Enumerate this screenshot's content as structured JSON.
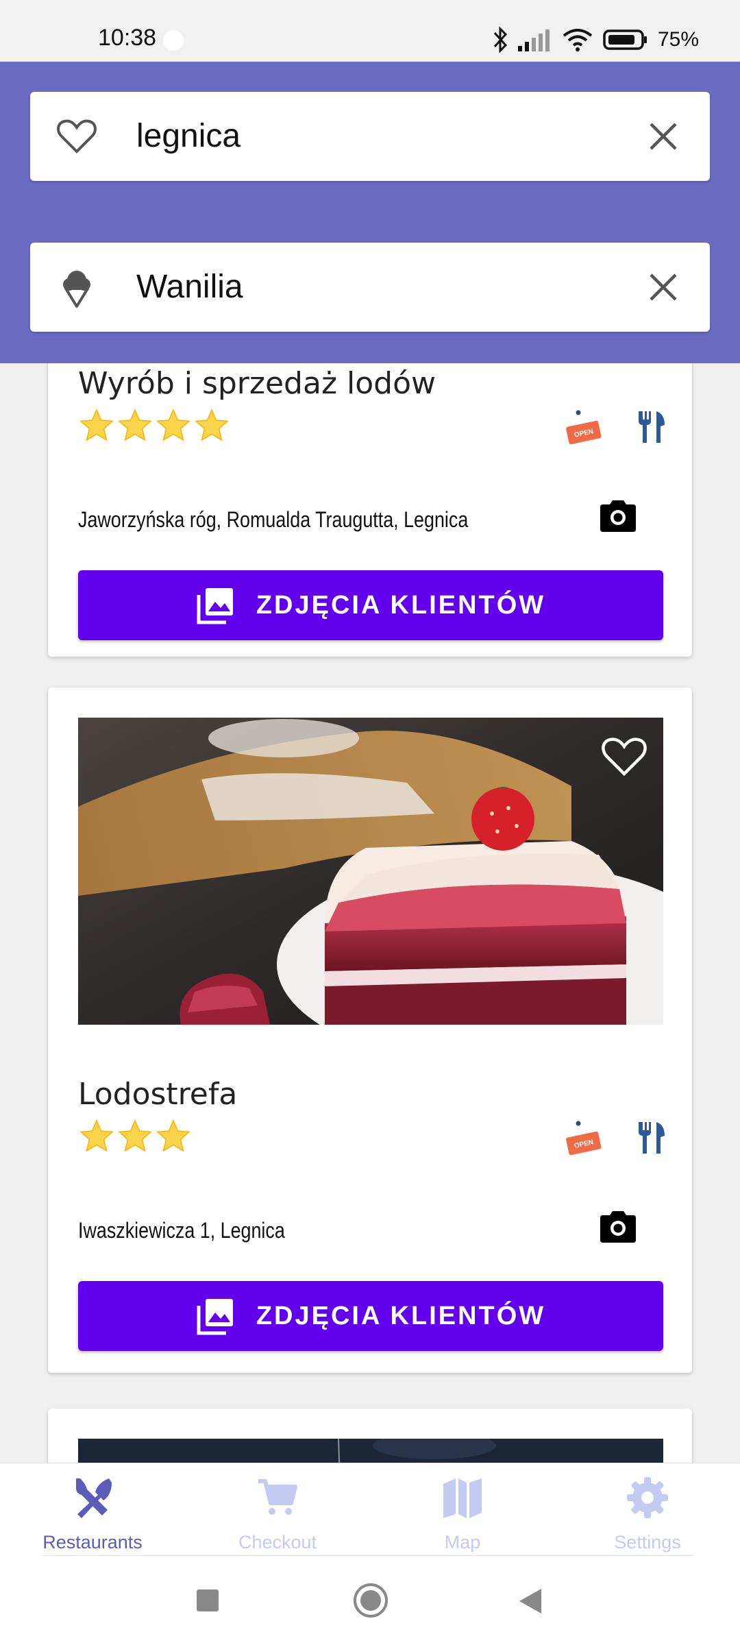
{
  "status_bar": {
    "time": "10:38",
    "battery": "75%"
  },
  "colors": {
    "header": "#6b6bc2",
    "button": "#6200ee",
    "nav_active": "#5b5bb8",
    "nav_inactive": "#c4cbf2"
  },
  "search": {
    "city_value": "legnica",
    "city_icon": "heart-outline-icon",
    "flavor_value": "Wanilia",
    "flavor_icon": "ice-cream-icon"
  },
  "cards": [
    {
      "name": "Wyrób i sprzedaż lodów",
      "rating": 4,
      "open_badge": "OPEN",
      "address": "Jaworzyńska róg, Romualda Traugutta, Legnica",
      "button_label": "ZDJĘCIA KLIENTÓW"
    },
    {
      "name": "Lodostrefa",
      "rating": 3,
      "open_badge": "OPEN",
      "address": "Iwaszkiewicza 1, Legnica",
      "button_label": "ZDJĘCIA KLIENTÓW"
    }
  ],
  "bottom_nav": [
    {
      "label": "Restaurants",
      "icon": "cutlery-cross-icon",
      "active": true
    },
    {
      "label": "Checkout",
      "icon": "cart-icon",
      "active": false
    },
    {
      "label": "Map",
      "icon": "map-icon",
      "active": false
    },
    {
      "label": "Settings",
      "icon": "gear-icon",
      "active": false
    }
  ]
}
